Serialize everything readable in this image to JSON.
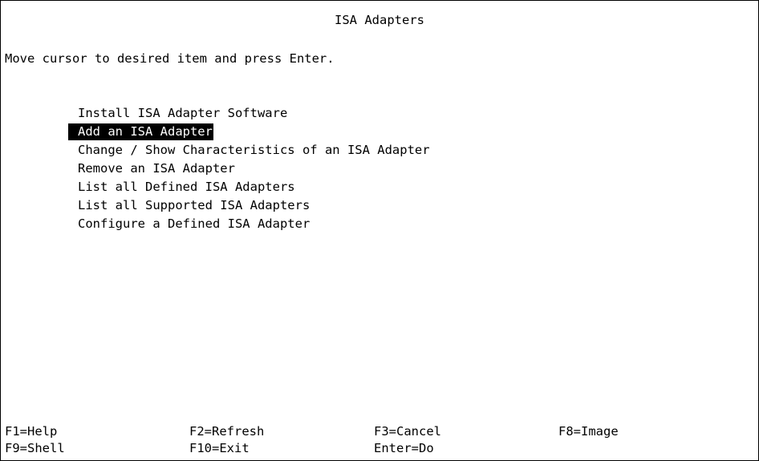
{
  "screen": {
    "title": "ISA Adapters",
    "instruction": "Move cursor to desired item and press Enter."
  },
  "menu": {
    "selected_index": 1,
    "items": [
      {
        "label": "Install ISA Adapter Software"
      },
      {
        "label": "Add an ISA Adapter"
      },
      {
        "label": "Change / Show Characteristics of an ISA Adapter"
      },
      {
        "label": "Remove an ISA Adapter"
      },
      {
        "label": "List all Defined ISA Adapters"
      },
      {
        "label": "List all Supported ISA Adapters"
      },
      {
        "label": "Configure a Defined ISA Adapter"
      }
    ]
  },
  "function_keys": {
    "row1": [
      {
        "label": "F1=Help"
      },
      {
        "label": "F2=Refresh"
      },
      {
        "label": "F3=Cancel"
      },
      {
        "label": "F8=Image"
      }
    ],
    "row2": [
      {
        "label": "F9=Shell"
      },
      {
        "label": "F10=Exit"
      },
      {
        "label": "Enter=Do"
      }
    ]
  },
  "colors": {
    "background": "#ffffff",
    "foreground": "#000000",
    "highlight_background": "#000000",
    "highlight_foreground": "#ffffff"
  }
}
